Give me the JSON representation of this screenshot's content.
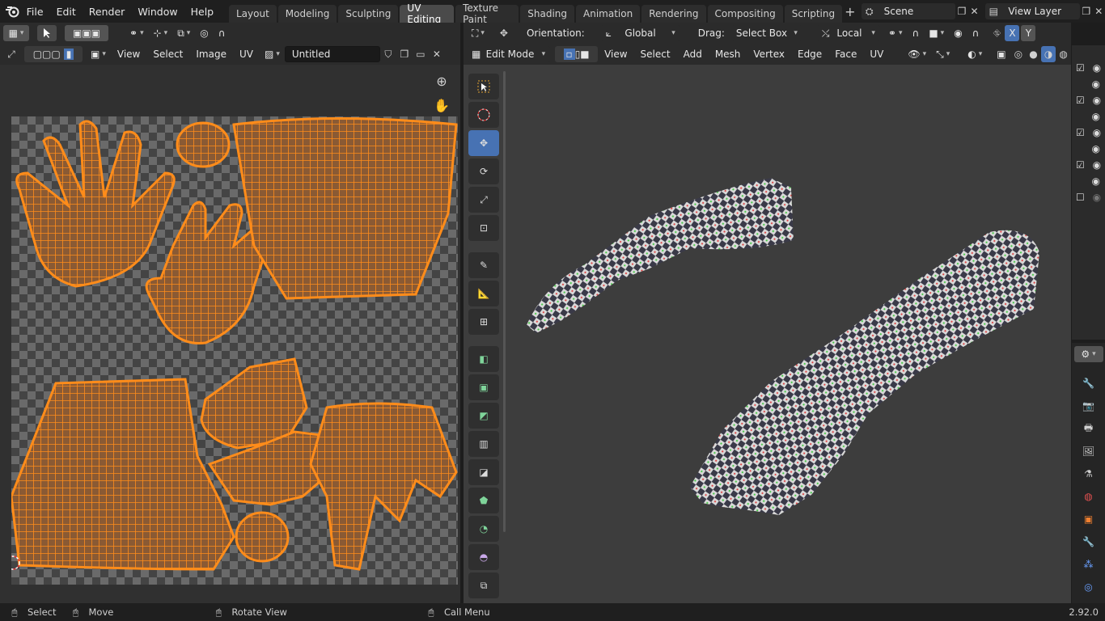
{
  "menubar": {
    "items": [
      "File",
      "Edit",
      "Render",
      "Window",
      "Help"
    ],
    "workspaces": [
      "Layout",
      "Modeling",
      "Sculpting",
      "UV Editing",
      "Texture Paint",
      "Shading",
      "Animation",
      "Rendering",
      "Compositing",
      "Scripting"
    ],
    "active_workspace": "UV Editing",
    "scene": "Scene",
    "view_layer": "View Layer"
  },
  "uv_editor": {
    "menus": [
      "View",
      "Select",
      "Image",
      "UV"
    ],
    "image_name": "Untitled"
  },
  "viewport": {
    "orientation_label": "Orientation:",
    "orientation_value": "Global",
    "drag_label": "Drag:",
    "drag_value": "Select Box",
    "pivot_value": "Local",
    "mode": "Edit Mode",
    "menus": [
      "View",
      "Select",
      "Add",
      "Mesh",
      "Vertex",
      "Edge",
      "Face",
      "UV"
    ],
    "axis_x": "X",
    "axis_y": "Y"
  },
  "statusbar": {
    "select": "Select",
    "move": "Move",
    "rotate": "Rotate View",
    "call_menu": "Call Menu",
    "version": "2.92.0"
  },
  "colors": {
    "accent": "#4772b3",
    "uv_orange": "#ff8c1a"
  }
}
